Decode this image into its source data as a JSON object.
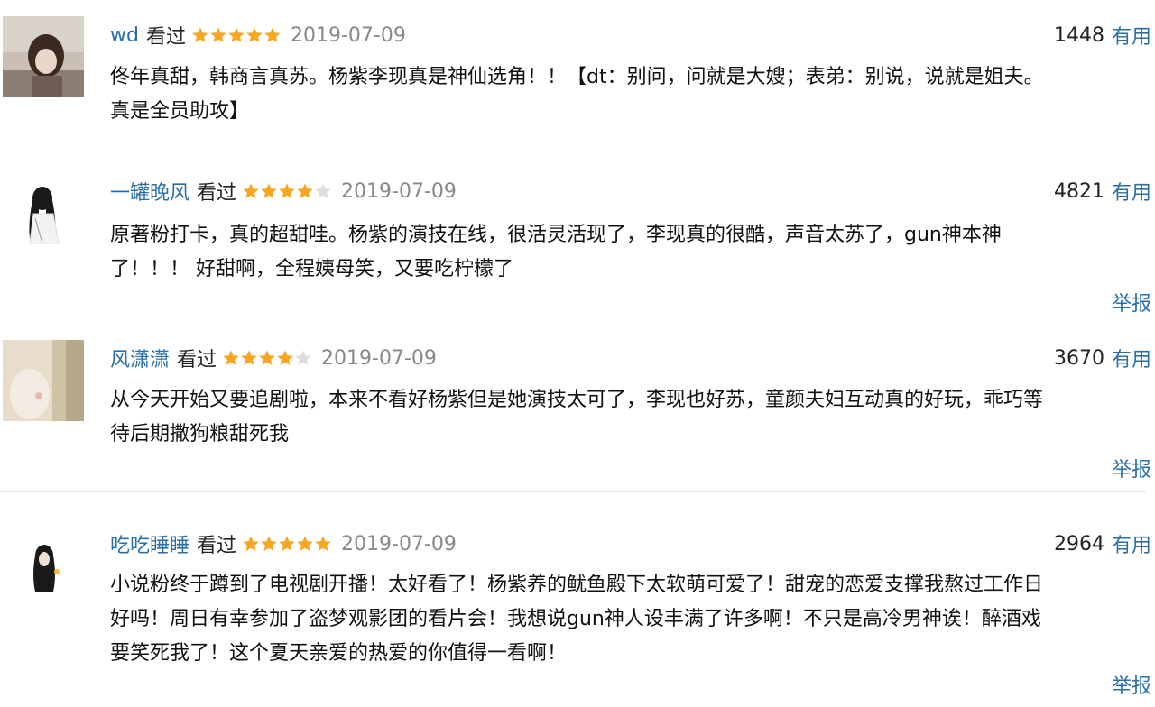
{
  "star_color": "#f5a623",
  "star_empty_color": "#dddddd",
  "comments": [
    {
      "author": "wd",
      "status": "看过",
      "rating": 5,
      "date": "2019-07-09",
      "votes": "1448",
      "useful_label": "有用",
      "text": "佟年真甜，韩商言真苏。杨紫李现真是神仙选角！！【dt：别问，问就是大嫂；表弟：别说，说就是姐夫。\n真是全员助攻】"
    },
    {
      "author": "一罐晚风",
      "status": "看过",
      "rating": 4,
      "date": "2019-07-09",
      "votes": "4821",
      "useful_label": "有用",
      "text": "原著粉打卡，真的超甜哇。杨紫的演技在线，很活灵活现了，李现真的很酷，声音太苏了，gun神本神\n了！！！ 好甜啊，全程姨母笑，又要吃柠檬了",
      "report_label": "举报"
    },
    {
      "author": "风潇潇",
      "status": "看过",
      "rating": 4,
      "date": "2019-07-09",
      "votes": "3670",
      "useful_label": "有用",
      "text": "从今天开始又要追剧啦，本来不看好杨紫但是她演技太可了，李现也好苏，童颜夫妇互动真的好玩，乖巧等\n待后期撒狗粮甜死我",
      "report_label": "举报"
    },
    {
      "author": "吃吃睡睡",
      "status": "看过",
      "rating": 5,
      "date": "2019-07-09",
      "votes": "2964",
      "useful_label": "有用",
      "text": "小说粉终于蹲到了电视剧开播！太好看了！杨紫养的鱿鱼殿下太软萌可爱了！甜宠的恋爱支撑我熬过工作日\n好吗！周日有幸参加了盗梦观影团的看片会！我想说gun神人设丰满了许多啊！不只是高冷男神诶！醉酒戏\n要笑死我了！这个夏天亲爱的热爱的你值得一看啊！",
      "report_label": "举报"
    }
  ]
}
